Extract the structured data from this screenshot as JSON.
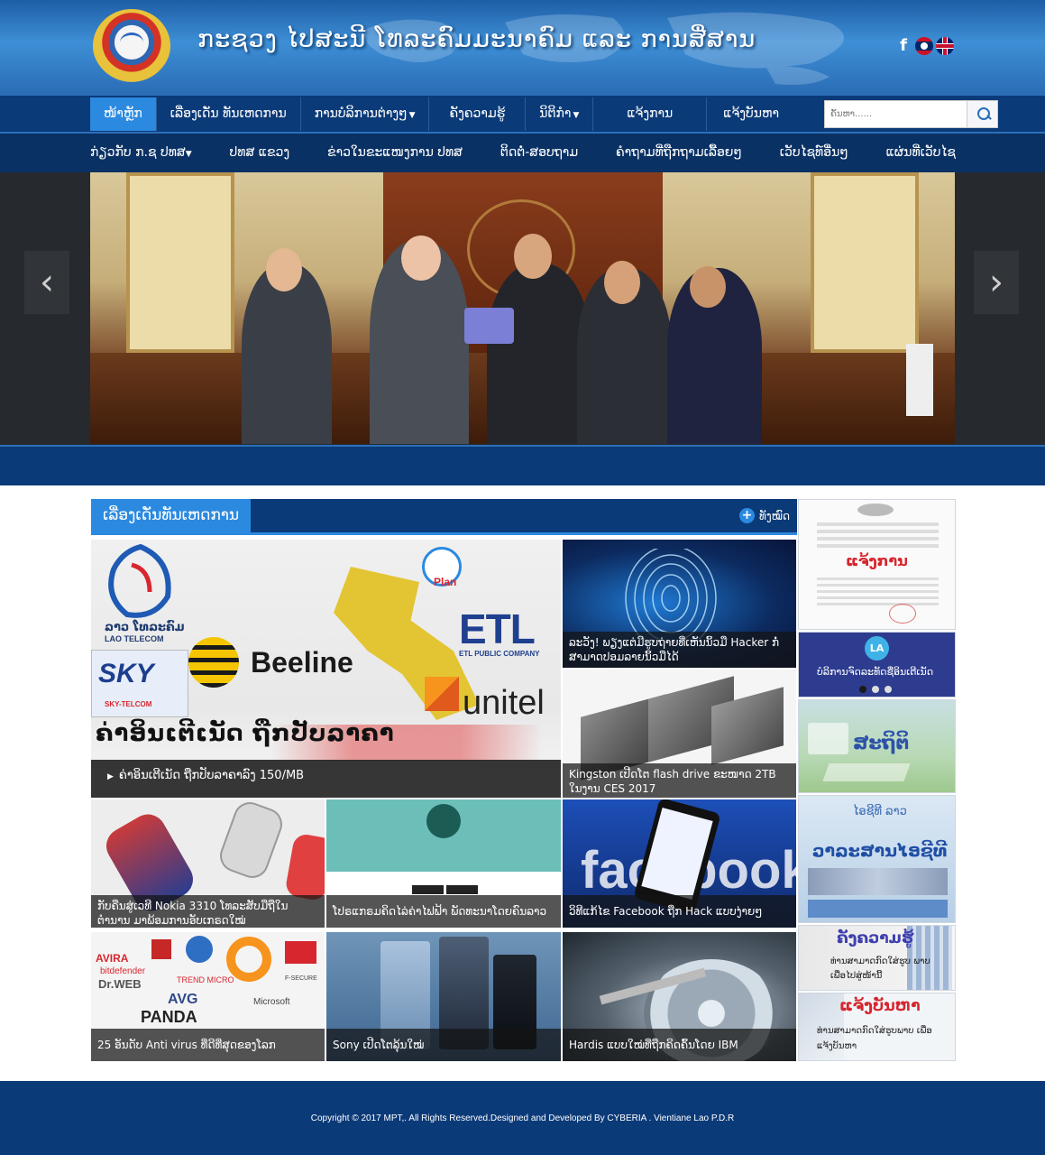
{
  "header": {
    "site_title": "ກະຊວງ ໄປສະນີ ໂທລະຄົມມະນາຄົມ ແລະ ການສື່ສານ",
    "icons": [
      "facebook-icon",
      "lao-flag-icon",
      "uk-flag-icon"
    ]
  },
  "nav_main": {
    "items": [
      {
        "label": "ໜ້າຫຼັກ",
        "active": true
      },
      {
        "label": "ເລື່ອງເດັ່ນ ທັນເຫດການ"
      },
      {
        "label": "ການບໍລິການຕ່າງໆ",
        "dropdown": true
      },
      {
        "label": "ຄັງຄວາມຮູ້"
      },
      {
        "label": "ນິຕິກຳ",
        "dropdown": true
      },
      {
        "label": "ແຈ້ງການ"
      },
      {
        "label": "ແຈ້ງບັນຫາ"
      }
    ],
    "search_placeholder": "ຄົ້ນຫາ......"
  },
  "nav_sub": {
    "items": [
      {
        "label": "ກ່ຽວກັບ ກ.ຊ ປທສ",
        "dropdown": true
      },
      {
        "label": "ປທສ ແຂວງ"
      },
      {
        "label": "ຂ່າວໃນຂະແໜງການ ປທສ"
      },
      {
        "label": "ຕິດຕໍ່-ສອບຖາມ"
      },
      {
        "label": "ຄຳຖາມທີ່ຖືກຖາມເລື້ອຍໆ"
      },
      {
        "label": "ເວັບໄຊທ໌ອື່ນໆ"
      },
      {
        "label": "ແຜ່ນທີ່ເວັບໄຊ"
      }
    ]
  },
  "slider": {
    "prev": "‹",
    "next": "›"
  },
  "news": {
    "section_title": "ເລື່ອງເດັ່ນທັນເຫດການ",
    "view_all": "ທັງໝົດ",
    "featured": {
      "caption": "ຄ່າອິນເຕີເນັດ ຖືກປັບລາຄາລົງ 150/MB",
      "headline": "ຄ່າອິນເຕີເນັດ ຖືກປັບລາຄາ",
      "brands": {
        "lao_telecom_lao": "ລາວ ໂທລະຄົມ",
        "lao_telecom": "LAO TELECOM",
        "sky": "SKY",
        "sky_sub": "SKY-TELCOM",
        "beeline": "Beeline",
        "etl": "ETL",
        "etl_sub": "ETL PUBLIC COMPANY",
        "unitel": "unitel",
        "plan": "Plan"
      }
    },
    "tiles": [
      {
        "caption": "ລະວັງ! ພຽງແຕ່ມີຮູບຖ່າຍທີ່ເຫັນນິ້ວມື Hacker ກໍ່ສາມາດປອມລາຍນິ້ວມືໄດ້"
      },
      {
        "caption": "Kingston ເປີດໂຕ flash drive ຂະໜາດ 2TB ໃນງານ CES 2017"
      },
      {
        "caption": "ກັບຄືນສູ່ເວທີ Nokia 3310 ໂທລະສັບມືຖືໃນຕຳນານ ມາພ້ອມການອັບເກຣດໃໝ່"
      },
      {
        "caption": "ໂປຣແກຣມຄິດໄລ່ຄ່າໄຟຟ້າ ພັດທະນາໂດຍຄົນລາວ"
      },
      {
        "caption": "ວິທີແກ້ໄຂ Facebook ຖືກ Hack ແບບງ່າຍໆ"
      },
      {
        "caption": "25 ອັນດັບ Anti virus ທີ່ດີທີ່ສຸດຂອງໂລກ"
      },
      {
        "caption": "Sony ເປີດໂຕລຸ້ນໃໝ່"
      },
      {
        "caption": "Hardis ແບບໃໝ່ທີ່ຖືກຄິດຄົ້ນໂດຍ IBM"
      }
    ],
    "antivirus_brands": [
      "AVIRA",
      "bitdefender",
      "Dr.WEB",
      "TREND MICRO",
      "AVG",
      "Microsoft",
      "PANDA",
      "F-SECURE"
    ],
    "facebook_word": "facebook"
  },
  "sidebar": {
    "notice_label": "ແຈ້ງການ",
    "service_label": "ບໍລິການຈົດລະທັດຊື່ອິນເຕີເນັດ",
    "la_badge": "LA",
    "stats_label": "ສະຖິຕິ",
    "ict_label": "ວາລະສານໄອຊີທີ",
    "ict_small": "ໄອຊີທີ ລາວ",
    "knowledge_label": "ຄັງຄວາມຮູ້",
    "knowledge_sub": "ທ່ານສາມາດກົດໃສ່ຮູບ ພາບເພື່ອໄປສູ່ໜ້ານີ້",
    "report_label": "ແຈ້ງບັນຫາ",
    "report_sub": "ທ່ານສາມາດກົດໃສ່ຮູບພາບ ເພື່ອແຈ້ງບັນຫາ"
  },
  "footer": {
    "text": "Copyright © 2017 MPT,. All Rights Reserved.Designed and Developed By CYBERIA . Vientiane Lao P.D.R"
  }
}
